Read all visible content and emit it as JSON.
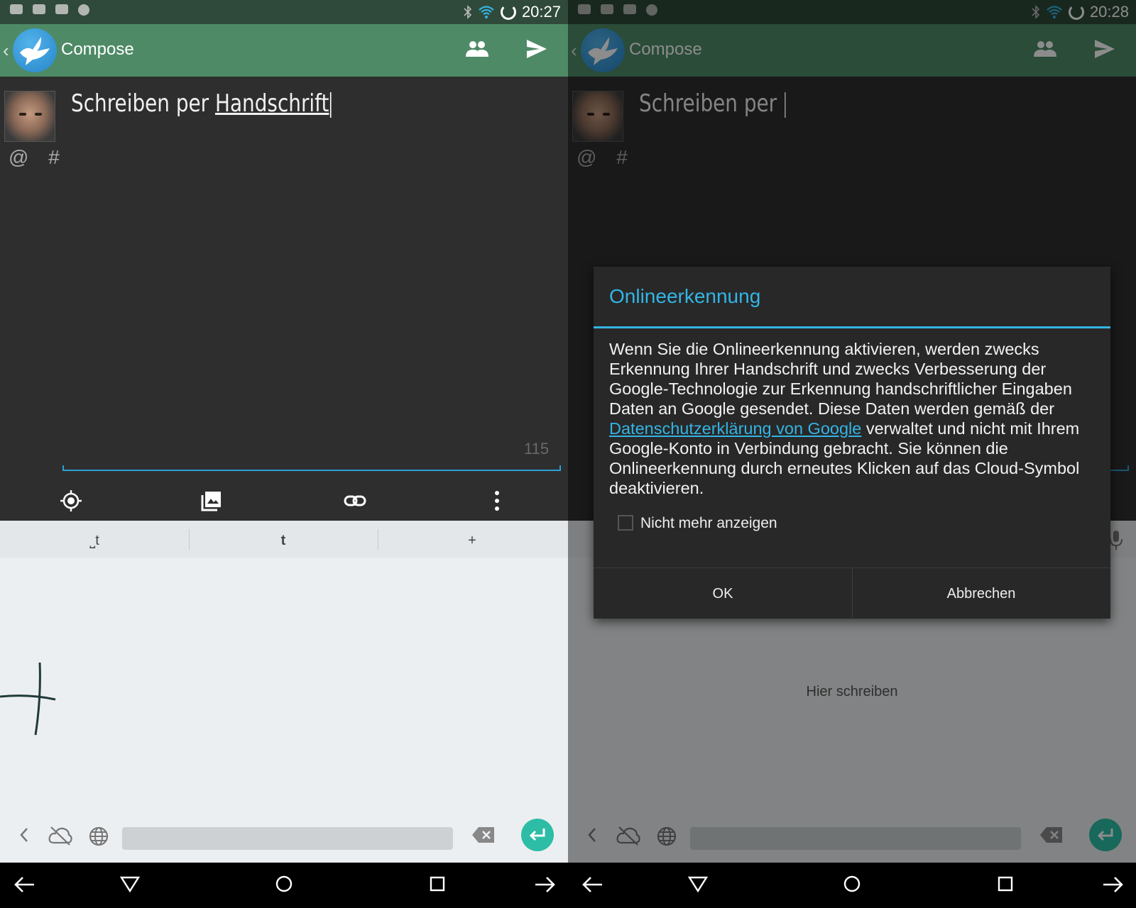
{
  "left": {
    "status": {
      "time": "20:27"
    },
    "appbar": {
      "title": "Compose"
    },
    "compose": {
      "text_plain": "Schreiben per ",
      "text_underlined": "Handschrift",
      "mention": "@ #",
      "remaining_chars": "115"
    },
    "keyboard": {
      "suggestions": [
        "⎵t",
        "t",
        "+"
      ],
      "strokes": "handwritten t"
    }
  },
  "right": {
    "status": {
      "time": "20:28"
    },
    "appbar": {
      "title": "Compose"
    },
    "compose": {
      "text_plain": "Schreiben per ",
      "mention": "@ #"
    },
    "dialog": {
      "title": "Onlineerkennung",
      "body_before_link": "Wenn Sie die Onlineerkennung aktivieren, werden zwecks Erkennung Ihrer Handschrift und zwecks Verbesserung der Google-Technologie zur Erkennung handschriftlicher Eingaben Daten an Google gesendet. Diese Daten werden gemäß der ",
      "link_text": "Datenschutzerklärung von Google",
      "body_after_link": " verwaltet und nicht mit Ihrem Google-Konto in Verbindung gebracht. Sie können die Onlineerkennung durch erneutes Klicken auf das Cloud-Symbol deaktivieren.",
      "checkbox_label": "Nicht mehr anzeigen",
      "checkbox_checked": false,
      "ok_label": "OK",
      "cancel_label": "Abbrechen"
    },
    "keyboard": {
      "write_hint": "Hier schreiben"
    }
  },
  "colors": {
    "appbar": "#4e8a66",
    "accent": "#33b5e5",
    "enter_key": "#2dbda6"
  }
}
